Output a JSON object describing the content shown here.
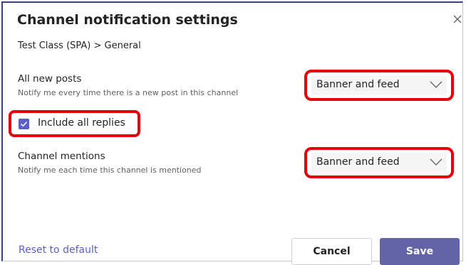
{
  "dialog": {
    "title": "Channel notification settings",
    "breadcrumb": "Test Class (SPA) > General"
  },
  "all_new_posts": {
    "title": "All new posts",
    "description": "Notify me every time there is a new post in this channel",
    "selected": "Banner and feed"
  },
  "include_replies": {
    "label": "Include all replies",
    "checked": true
  },
  "channel_mentions": {
    "title": "Channel mentions",
    "description": "Notify me each time this channel is mentioned",
    "selected": "Banner and feed"
  },
  "footer": {
    "reset_label": "Reset to default",
    "cancel_label": "Cancel",
    "save_label": "Save"
  },
  "icons": {
    "close": "close-icon",
    "chevron": "chevron-down-icon",
    "check": "checkmark-icon"
  },
  "colors": {
    "accent": "#5b5fc7",
    "save_button": "#6264a7",
    "highlight": "#e8000b"
  }
}
